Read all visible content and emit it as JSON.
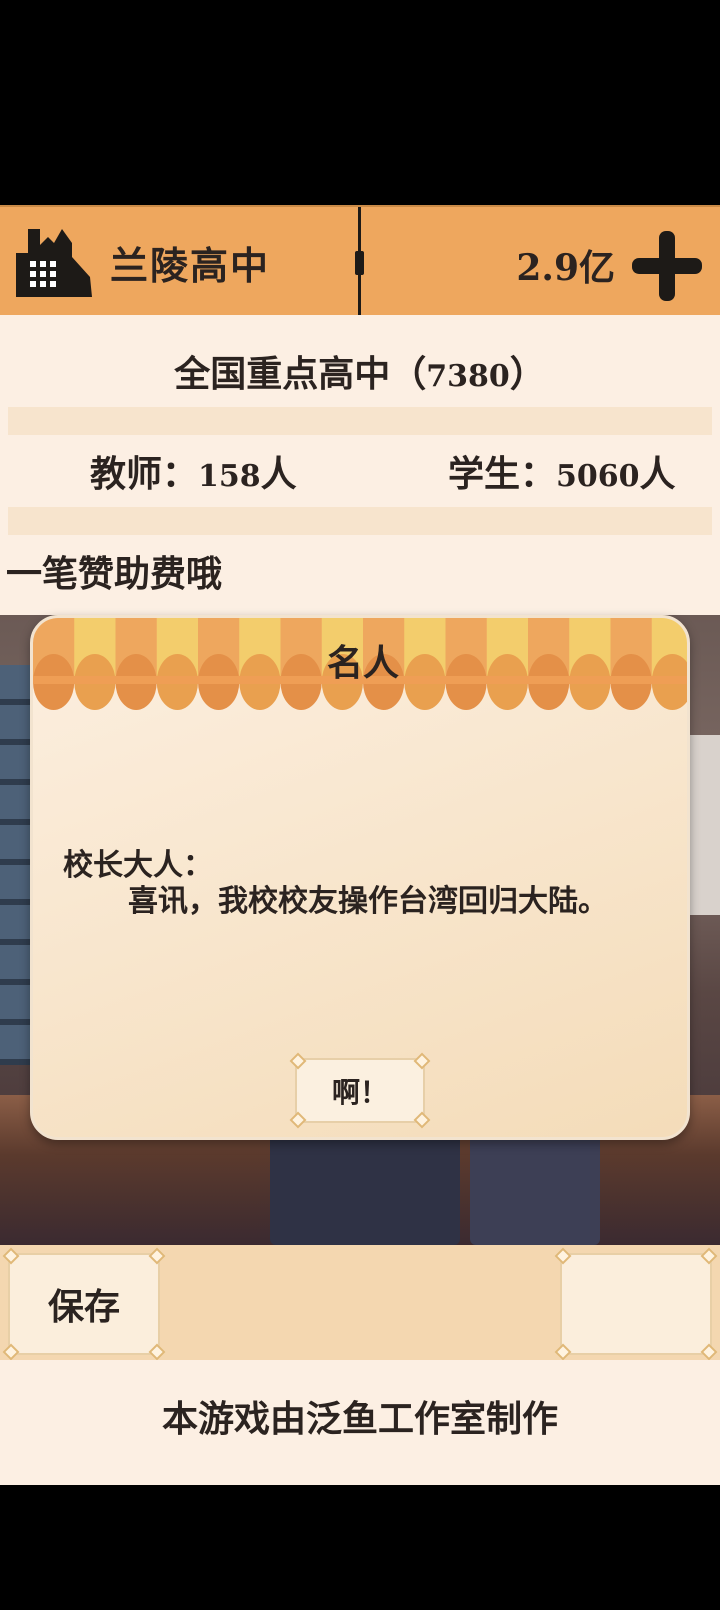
{
  "header": {
    "school_name": "兰陵高中",
    "money": "2.9亿",
    "icons": {
      "school": "school-building-icon",
      "add": "plus-icon"
    }
  },
  "info": {
    "rank_title": "全国重点高中",
    "rank_paren_open": "（",
    "rank_value": "7380",
    "rank_paren_close": "）",
    "teachers_label": "教师：",
    "teachers_value": "158",
    "teachers_unit": "人",
    "students_label": "学生：",
    "students_value": "5060",
    "students_unit": "人",
    "message": "一笔赞助费哦"
  },
  "dialog": {
    "title": "名人",
    "greeting": "校长大人：",
    "body": "喜讯，我校校友操作台湾回归大陆。",
    "confirm_label": "啊！"
  },
  "bottom": {
    "save_label": "保存",
    "credit": "本游戏由泛鱼工作室制作"
  },
  "colors": {
    "header_bg": "#eea75e",
    "panel_bg": "#fcefe3",
    "awning_orange": "#eea75e",
    "awning_yellow": "#f3cd6c",
    "text": "#2b2320"
  }
}
